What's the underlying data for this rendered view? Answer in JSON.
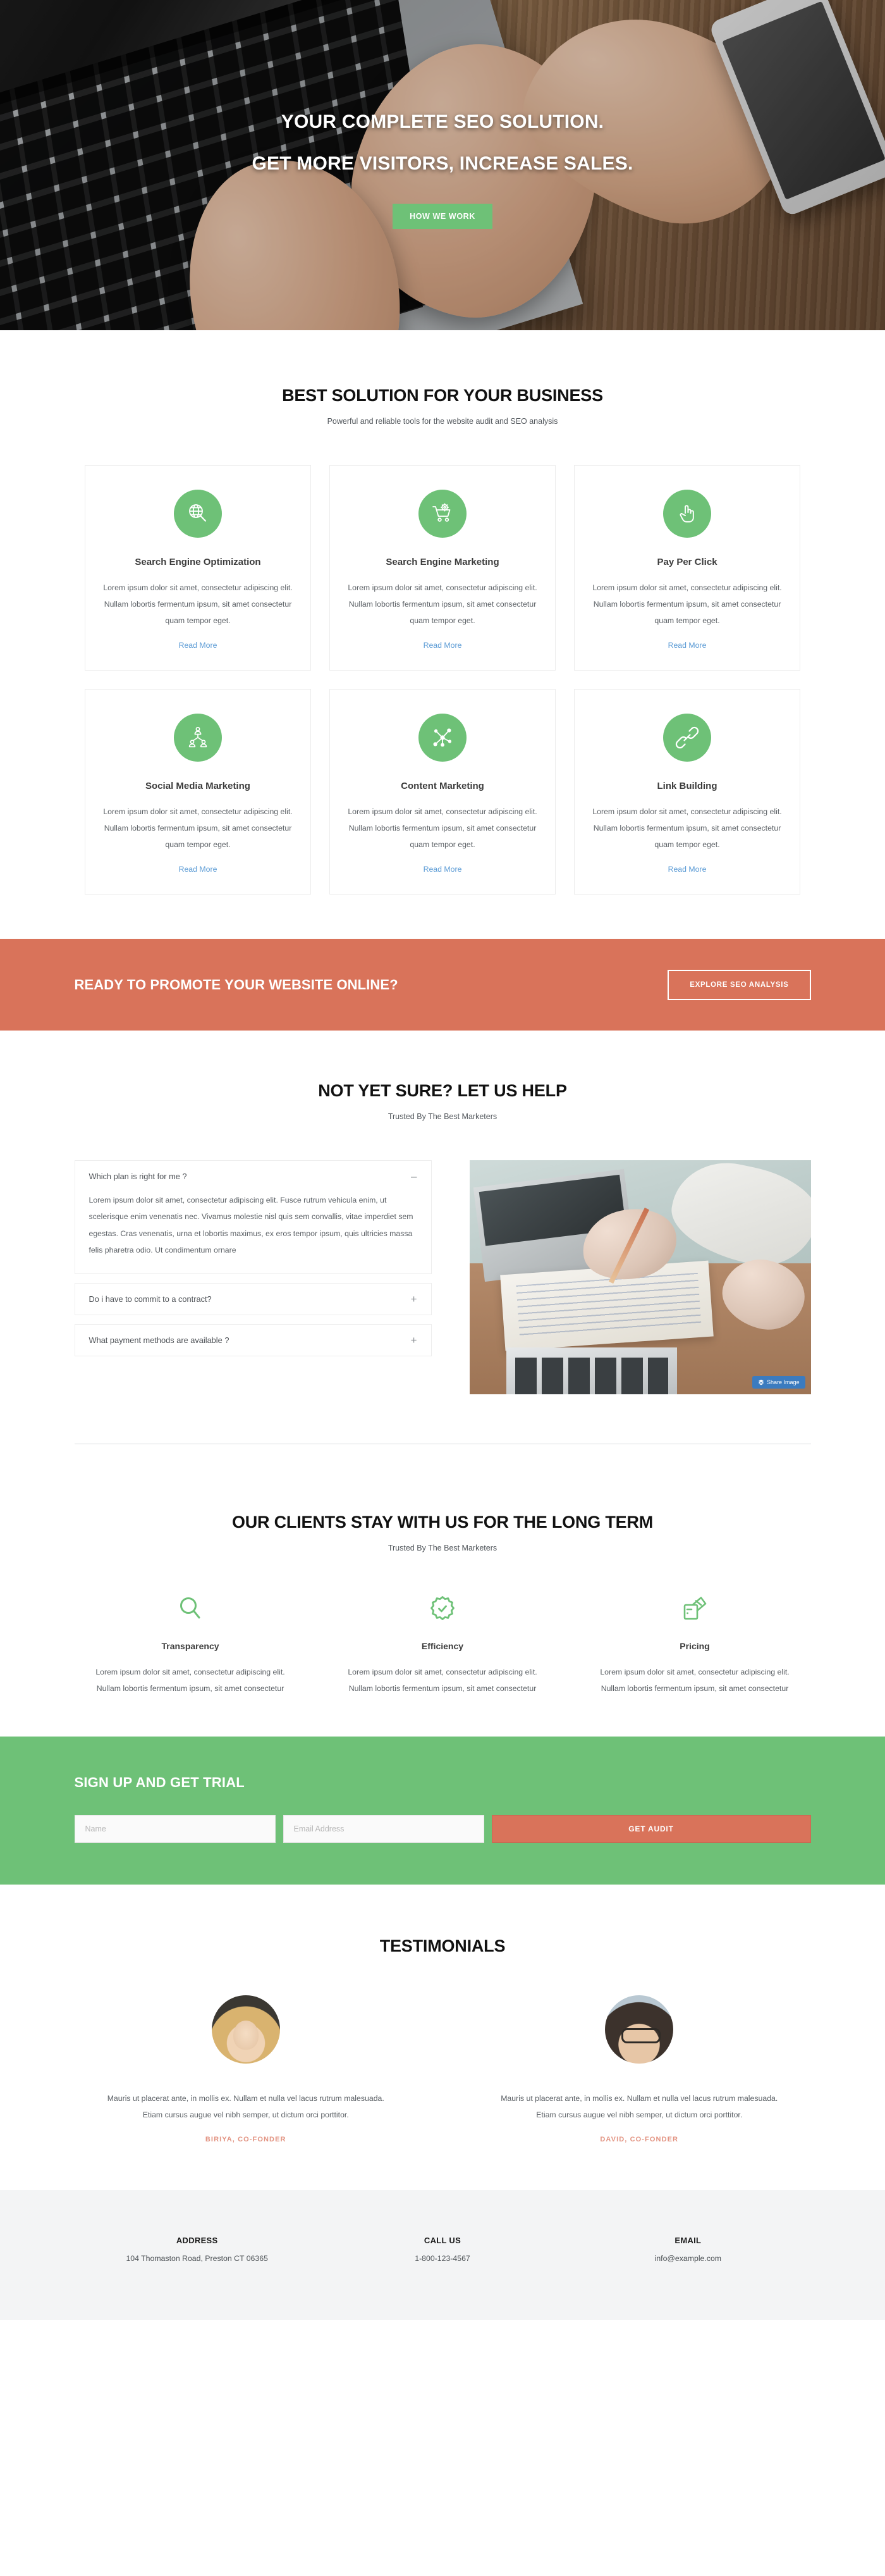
{
  "hero": {
    "headline_line1": "YOUR COMPLETE SEO SOLUTION.",
    "headline_line2": "GET MORE VISITORS, INCREASE SALES.",
    "cta_label": "HOW WE WORK"
  },
  "services_section": {
    "title": "BEST SOLUTION FOR YOUR BUSINESS",
    "subtitle": "Powerful and reliable tools for the website audit and SEO analysis",
    "read_more_label": "Read More",
    "accent_color": "#6ec177",
    "link_color": "#5b9bd5",
    "cards": [
      {
        "icon": "globe-search-icon",
        "title": "Search Engine Optimization",
        "description": "Lorem ipsum dolor sit amet, consectetur adipiscing elit. Nullam lobortis fermentum ipsum, sit amet consectetur quam tempor eget.",
        "link": "Read More"
      },
      {
        "icon": "shopping-cart-gear-icon",
        "title": "Search Engine Marketing",
        "description": "Lorem ipsum dolor sit amet, consectetur adipiscing elit. Nullam lobortis fermentum ipsum, sit amet consectetur quam tempor eget.",
        "link": "Read More"
      },
      {
        "icon": "pointing-hand-icon",
        "title": "Pay Per Click",
        "description": "Lorem ipsum dolor sit amet, consectetur adipiscing elit. Nullam lobortis fermentum ipsum, sit amet consectetur quam tempor eget.",
        "link": "Read More"
      },
      {
        "icon": "org-chart-people-icon",
        "title": "Social Media Marketing",
        "description": "Lorem ipsum dolor sit amet, consectetur adipiscing elit. Nullam lobortis fermentum ipsum, sit amet consectetur quam tempor eget.",
        "link": "Read More"
      },
      {
        "icon": "network-nodes-icon",
        "title": "Content Marketing",
        "description": "Lorem ipsum dolor sit amet, consectetur adipiscing elit. Nullam lobortis fermentum ipsum, sit amet consectetur quam tempor eget.",
        "link": "Read More"
      },
      {
        "icon": "chain-link-icon",
        "title": "Link Building",
        "description": "Lorem ipsum dolor sit amet, consectetur adipiscing elit. Nullam lobortis fermentum ipsum, sit amet consectetur quam tempor eget.",
        "link": "Read More"
      }
    ]
  },
  "promo_banner": {
    "title": "READY TO PROMOTE YOUR WEBSITE ONLINE?",
    "button_label": "EXPLORE SEO ANALYSIS",
    "background_color": "#d9735a"
  },
  "faq_section": {
    "title": "NOT YET SURE? LET US HELP",
    "subtitle": "Trusted By The Best Marketers",
    "items": [
      {
        "question": "Which plan is right for me ?",
        "sign": "–",
        "expanded": true,
        "answer": "Lorem ipsum dolor sit amet, consectetur adipiscing elit. Fusce rutrum vehicula enim, ut scelerisque enim venenatis nec. Vivamus molestie nisl quis sem convallis, vitae imperdiet sem egestas. Cras venenatis, urna et lobortis maximus, ex eros tempor ipsum, quis ultricies massa felis pharetra odio. Ut condimentum ornare"
      },
      {
        "question": "Do i have to commit to a contract?",
        "sign": "+",
        "expanded": false,
        "answer": ""
      },
      {
        "question": "What payment methods are available ?",
        "sign": "+",
        "expanded": false,
        "answer": ""
      }
    ],
    "image_badge_label": "Share Image"
  },
  "clients_section": {
    "title": "OUR CLIENTS STAY WITH US FOR THE LONG TERM",
    "subtitle": "Trusted By The Best Marketers",
    "items": [
      {
        "icon": "magnifier-icon",
        "title": "Transparency",
        "description": "Lorem ipsum dolor sit amet, consectetur adipiscing elit. Nullam lobortis fermentum ipsum, sit amet consectetur"
      },
      {
        "icon": "gear-check-icon",
        "title": "Efficiency",
        "description": "Lorem ipsum dolor sit amet, consectetur adipiscing elit. Nullam lobortis fermentum ipsum, sit amet consectetur"
      },
      {
        "icon": "credit-card-wallet-icon",
        "title": "Pricing",
        "description": "Lorem ipsum dolor sit amet, consectetur adipiscing elit. Nullam lobortis fermentum ipsum, sit amet consectetur"
      }
    ]
  },
  "signup_section": {
    "title": "SIGN UP AND GET TRIAL",
    "name_placeholder": "Name",
    "name_value": "",
    "email_placeholder": "Email Address",
    "email_value": "",
    "submit_label": "GET AUDIT",
    "background_color": "#6ec177",
    "submit_color": "#d9735a"
  },
  "testimonials_section": {
    "title": "TESTIMONIALS",
    "author_color": "#e29280",
    "items": [
      {
        "avatar": "avatar-woman",
        "quote": "Mauris ut placerat ante, in mollis ex. Nullam et nulla vel lacus rutrum malesuada. Etiam cursus augue vel nibh semper, ut dictum orci porttitor.",
        "author": "BIRIYA, CO-FONDER"
      },
      {
        "avatar": "avatar-man",
        "quote": "Mauris ut placerat ante, in mollis ex. Nullam et nulla vel lacus rutrum malesuada. Etiam cursus augue vel nibh semper, ut dictum orci porttitor.",
        "author": "DAVID, CO-FONDER"
      }
    ]
  },
  "footer": {
    "columns": [
      {
        "heading": "ADDRESS",
        "value": "104 Thomaston Road, Preston CT 06365"
      },
      {
        "heading": "CALL US",
        "value": "1-800-123-4567"
      },
      {
        "heading": "EMAIL",
        "value": "info@example.com"
      }
    ]
  }
}
